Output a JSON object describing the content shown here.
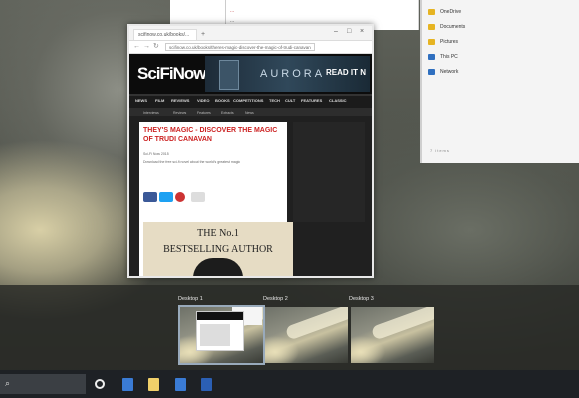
{
  "browser": {
    "tab_title": "scifinow.co.uk/books/...",
    "new_tab": "+",
    "controls": [
      "–",
      "□",
      "×"
    ],
    "back": "←",
    "forward": "→",
    "refresh": "↻",
    "url": "scifinow.co.uk/books/theres-magic-discover-the-magic-of-trudi-canavan",
    "site": {
      "logo": "SciFiNow",
      "banner_text": "AURORA",
      "banner_cta": "READ IT N",
      "menu": [
        "NEWS",
        "FILM",
        "REVIEWS",
        "VIDEO",
        "BOOKS",
        "COMPETITIONS",
        "TECH",
        "CULT",
        "FEATURES",
        "CLASSIC"
      ],
      "submenu": [
        "Interviews",
        "Reviews",
        "Features",
        "Extracts",
        "News"
      ],
      "article_title": "THEY'S MAGIC - DISCOVER THE MAGIC OF TRUDI CANAVAN",
      "meta_line1": "Sci-Fi Now 2015",
      "meta_line2": "Download the free sci-fi novel about the world's greatest magic",
      "promo_line1": "THE No.1",
      "promo_line2": "BESTSELLING AUTHOR"
    }
  },
  "explorer": {
    "items": [
      {
        "label": "OneDrive",
        "color": "#e6b422"
      },
      {
        "label": "Documents",
        "color": "#e6b422"
      },
      {
        "label": "Pictures",
        "color": "#e6b422"
      },
      {
        "label": "This PC",
        "color": "#2f6fbf"
      },
      {
        "label": "Network",
        "color": "#2f6fbf"
      }
    ],
    "status": "7 items"
  },
  "document": {
    "line1": "...",
    "line2": "..."
  },
  "desktops": [
    {
      "label": "Desktop 1",
      "active": true
    },
    {
      "label": "Desktop 2",
      "active": false
    },
    {
      "label": "Desktop 3",
      "active": false
    }
  ],
  "taskbar": {
    "search_glyph": "⌕",
    "apps": [
      {
        "name": "task-view",
        "color": "#ffffff"
      },
      {
        "name": "edge",
        "color": "#3a7bd5"
      },
      {
        "name": "file-explorer",
        "color": "#f1d06a"
      },
      {
        "name": "store",
        "color": "#3a7bd5"
      },
      {
        "name": "word",
        "color": "#2b5fb4"
      }
    ]
  }
}
